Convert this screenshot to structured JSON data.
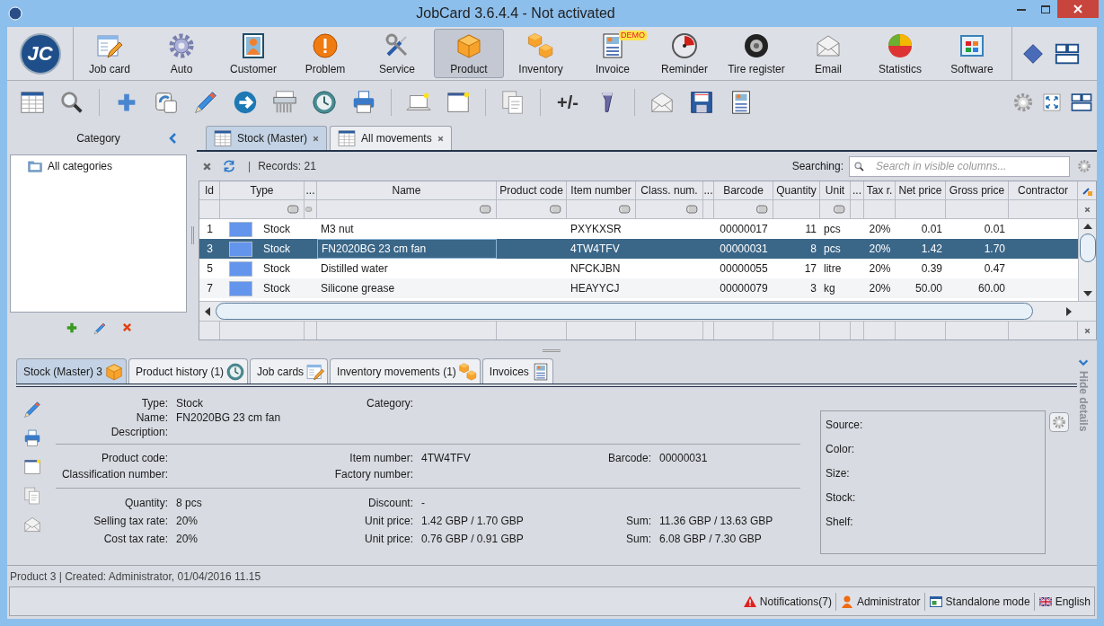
{
  "window": {
    "title": "JobCard 3.6.4.4 - Not activated"
  },
  "logo": "JC",
  "modules": [
    {
      "label": "Job card",
      "selected": false
    },
    {
      "label": "Auto",
      "selected": false
    },
    {
      "label": "Customer",
      "selected": false
    },
    {
      "label": "Problem",
      "selected": false
    },
    {
      "label": "Service",
      "selected": false
    },
    {
      "label": "Product",
      "selected": true
    },
    {
      "label": "Inventory",
      "selected": false
    },
    {
      "label": "Invoice",
      "selected": false,
      "badge": "DEMO"
    },
    {
      "label": "Reminder",
      "selected": false
    },
    {
      "label": "Tire register",
      "selected": false
    },
    {
      "label": "Email",
      "selected": false
    },
    {
      "label": "Statistics",
      "selected": false
    },
    {
      "label": "Software",
      "selected": false
    }
  ],
  "toolbar": {
    "adjust_label": "+/-"
  },
  "category_panel": {
    "title": "Category",
    "items": [
      {
        "label": "All categories",
        "selected": false
      }
    ]
  },
  "document_tabs": [
    {
      "label": "Stock (Master)",
      "selected": true
    },
    {
      "label": "All movements",
      "selected": false
    }
  ],
  "grid": {
    "records_separator": "|",
    "records": "Records: 21",
    "search_label": "Searching:",
    "search_placeholder": "Search in visible columns...",
    "columns": [
      {
        "label": "Id",
        "filter": false
      },
      {
        "label": "Type",
        "filter": true
      },
      {
        "label": "...",
        "filter": true
      },
      {
        "label": "Name",
        "filter": true
      },
      {
        "label": "Product code",
        "filter": true
      },
      {
        "label": "Item number",
        "filter": true
      },
      {
        "label": "Class. num.",
        "filter": true
      },
      {
        "label": "...",
        "filter": false
      },
      {
        "label": "Barcode",
        "filter": true
      },
      {
        "label": "Quantity",
        "filter": false
      },
      {
        "label": "Unit",
        "filter": true
      },
      {
        "label": "...",
        "filter": false
      },
      {
        "label": "Tax r.",
        "filter": false
      },
      {
        "label": "Net price",
        "filter": false
      },
      {
        "label": "Gross price",
        "filter": false
      },
      {
        "label": "Contractor",
        "filter": false
      }
    ],
    "rows": [
      {
        "selected": false,
        "color": "#6495ed",
        "id": "1",
        "type": "Stock",
        "name": "M3 nut",
        "item_number": "PXYKXSR",
        "barcode": "00000017",
        "quantity": "11",
        "unit": "pcs",
        "tax_rate": "20%",
        "net_price": "0.01",
        "gross_price": "0.01"
      },
      {
        "selected": true,
        "color": "#6495ed",
        "id": "3",
        "type": "Stock",
        "name": "FN2020BG 23 cm fan",
        "item_number": "4TW4TFV",
        "barcode": "00000031",
        "quantity": "8",
        "unit": "pcs",
        "tax_rate": "20%",
        "net_price": "1.42",
        "gross_price": "1.70"
      },
      {
        "selected": false,
        "color": "#6495ed",
        "id": "5",
        "type": "Stock",
        "name": "Distilled water",
        "item_number": "NFCKJBN",
        "barcode": "00000055",
        "quantity": "17",
        "unit": "litre",
        "tax_rate": "20%",
        "net_price": "0.39",
        "gross_price": "0.47"
      },
      {
        "selected": false,
        "color": "#6495ed",
        "id": "7",
        "type": "Stock",
        "name": "Silicone grease",
        "item_number": "HEAYYCJ",
        "barcode": "00000079",
        "quantity": "3",
        "unit": "kg",
        "tax_rate": "20%",
        "net_price": "50.00",
        "gross_price": "60.00"
      }
    ]
  },
  "detail_tabs": [
    {
      "label": "Stock (Master) 3",
      "selected": true
    },
    {
      "label": "Product history (1)",
      "selected": false
    },
    {
      "label": "Job cards",
      "selected": false
    },
    {
      "label": "Inventory movements (1)",
      "selected": false
    },
    {
      "label": "Invoices",
      "selected": false
    }
  ],
  "details": {
    "sections": [
      {
        "rows": [
          {
            "left": {
              "label": "Type:",
              "value": "Stock"
            },
            "center": {
              "label": "Category:"
            }
          },
          {
            "left": {
              "label": "Name:",
              "value": "FN2020BG 23 cm fan"
            }
          },
          {
            "left": {
              "label": "Description:"
            }
          }
        ]
      },
      {
        "rows": [
          {
            "left": {
              "label": "Product code:"
            },
            "center": {
              "label": "Item number:",
              "value": "4TW4TFV"
            },
            "right": {
              "label": "Barcode:",
              "value": "00000031"
            }
          },
          {
            "left": {
              "label": "Classification number:"
            },
            "center": {
              "label": "Factory number:"
            }
          }
        ]
      },
      {
        "rows": [
          {
            "left": {
              "label": "Quantity:",
              "value": "8 pcs"
            },
            "center": {
              "label": "Discount:",
              "value": "-"
            }
          },
          {
            "left": {
              "label": "Selling tax rate:",
              "value": "20%"
            },
            "center": {
              "label": "Unit price:",
              "value": "1.42 GBP / 1.70 GBP"
            },
            "right": {
              "label": "Sum:",
              "value": "11.36 GBP / 13.63 GBP"
            }
          },
          {
            "left": {
              "label": "Cost tax rate:",
              "value": "20%"
            },
            "center": {
              "label": "Unit price:",
              "value": "0.76 GBP / 0.91 GBP"
            },
            "right": {
              "label": "Sum:",
              "value": "6.08 GBP / 7.30 GBP"
            }
          }
        ]
      }
    ],
    "attributes": [
      "Source:",
      "Color:",
      "Size:",
      "Stock:",
      "Shelf:"
    ],
    "hide_label": "Hide details"
  },
  "status_line": "Product 3 | Created: Administrator, 01/04/2016 11.15",
  "status_bar": [
    {
      "label": "Notifications(7)"
    },
    {
      "label": "Administrator"
    },
    {
      "label": "Standalone mode"
    },
    {
      "label": "English"
    }
  ]
}
